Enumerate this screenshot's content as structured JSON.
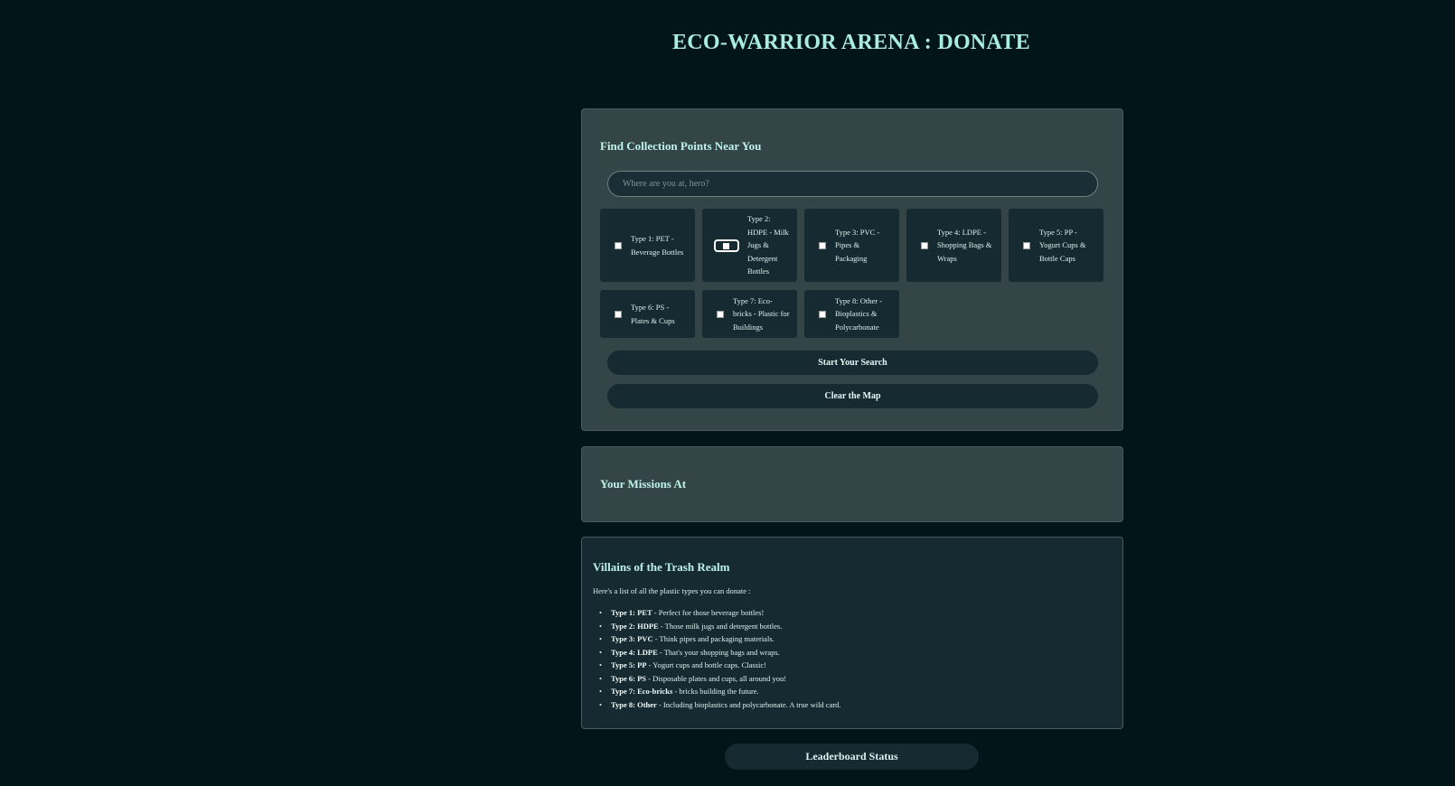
{
  "header": {
    "title": "ECO-WARRIOR ARENA : DONATE"
  },
  "search_panel": {
    "heading": "Find Collection Points Near You",
    "input_placeholder": "Where are you at, hero?",
    "input_value": "",
    "types": [
      {
        "label": "Type 1: PET - Beverage Bottles",
        "checked": false
      },
      {
        "label": "Type 2: HDPE - Milk Jugs & Detergent Bottles",
        "checked": false,
        "focused": true
      },
      {
        "label": "Type 3: PVC - Pipes & Packaging",
        "checked": false
      },
      {
        "label": "Type 4: LDPE - Shopping Bags & Wraps",
        "checked": false
      },
      {
        "label": "Type 5: PP - Yogurt Cups & Bottle Caps",
        "checked": false
      },
      {
        "label": "Type 6: PS - Plates & Cups",
        "checked": false
      },
      {
        "label": "Type 7: Eco-bricks - Plastic for Buildings",
        "checked": false
      },
      {
        "label": "Type 8: Other - Bioplastics & Polycarbonate",
        "checked": false
      }
    ],
    "search_button": "Start Your Search",
    "clear_button": "Clear the Map"
  },
  "missions_panel": {
    "heading": "Your Missions At"
  },
  "villains_panel": {
    "heading": "Villains of the Trash Realm",
    "intro": "Here's a list of all the plastic types you can donate :",
    "items": [
      {
        "name": "Type 1: PET",
        "desc": " - Perfect for those beverage bottles!"
      },
      {
        "name": "Type 2: HDPE",
        "desc": " - Those milk jugs and detergent bottles."
      },
      {
        "name": "Type 3: PVC",
        "desc": " - Think pipes and packaging materials."
      },
      {
        "name": "Type 4: LDPE",
        "desc": " - That's your shopping bags and wraps."
      },
      {
        "name": "Type 5: PP",
        "desc": " - Yogurt cups and bottle caps. Classic!"
      },
      {
        "name": "Type 6: PS",
        "desc": " - Disposable plates and cups, all around you!"
      },
      {
        "name": "Type 7: Eco-bricks",
        "desc": " - bricks building the future."
      },
      {
        "name": "Type 8: Other",
        "desc": " - Including bioplastics and polycarbonate. A true wild card."
      }
    ]
  },
  "footer": {
    "leaderboard_button": "Leaderboard Status"
  },
  "colors": {
    "background": "#02161a",
    "panel": "#344547",
    "card": "#162a31",
    "accent_text": "#a9ece2"
  }
}
